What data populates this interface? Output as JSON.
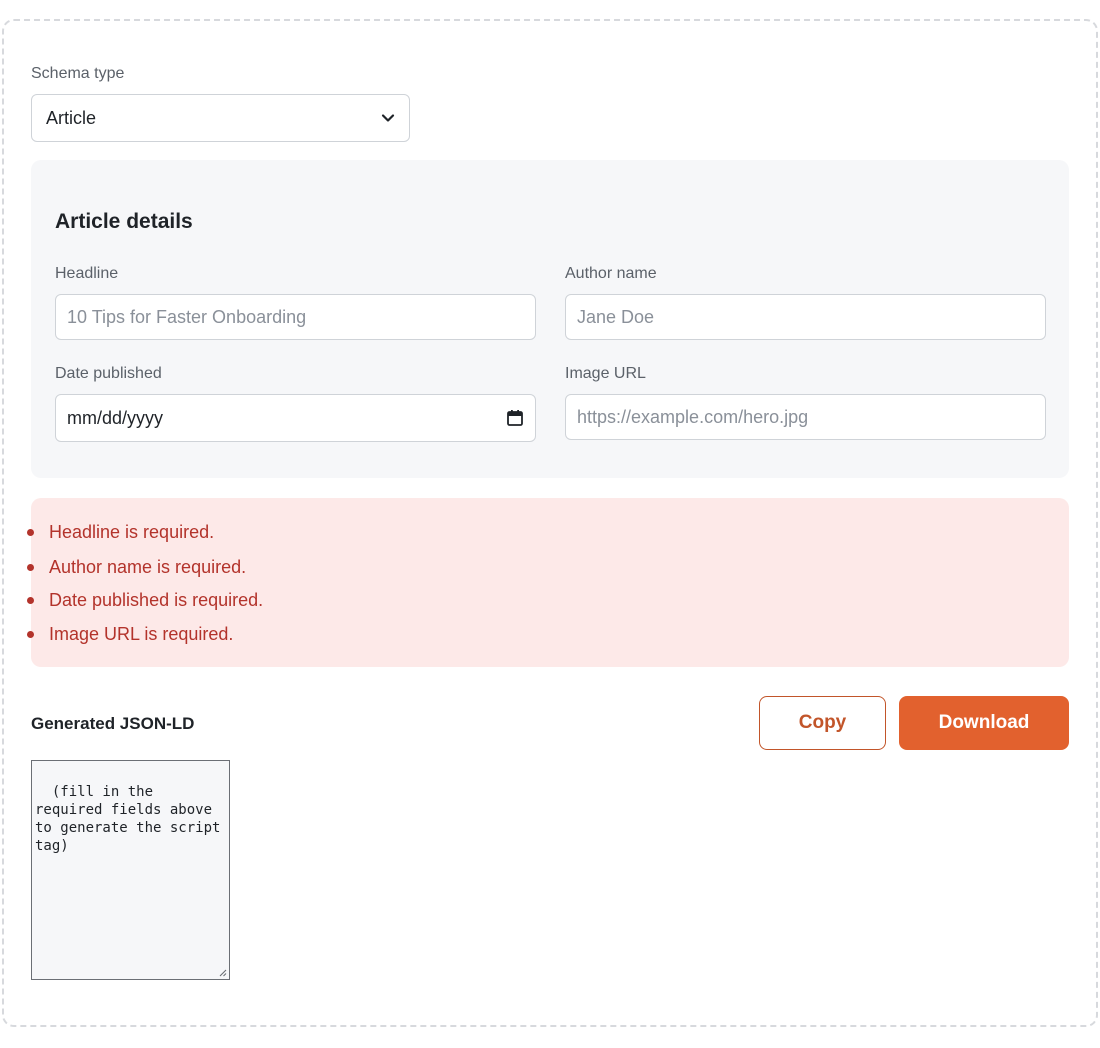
{
  "schema": {
    "label": "Schema type",
    "selected": "Article"
  },
  "details": {
    "title": "Article details",
    "fields": {
      "headline": {
        "label": "Headline",
        "placeholder": "10 Tips for Faster Onboarding"
      },
      "author": {
        "label": "Author name",
        "placeholder": "Jane Doe"
      },
      "date": {
        "label": "Date published",
        "value": "mm/dd/yyyy"
      },
      "image": {
        "label": "Image URL",
        "placeholder": "https://example.com/hero.jpg"
      }
    }
  },
  "errors": [
    "Headline is required.",
    "Author name is required.",
    "Date published is required.",
    "Image URL is required."
  ],
  "output": {
    "title": "Generated JSON-LD",
    "copy_label": "Copy",
    "download_label": "Download",
    "textarea_value": "(fill in the required fields above to generate the script tag)"
  },
  "colors": {
    "accent": "#e2612e",
    "error_text": "#b3332b",
    "error_bg": "#fde9e8"
  },
  "icons": {
    "select": "chevron-down-icon",
    "date": "calendar-icon"
  }
}
